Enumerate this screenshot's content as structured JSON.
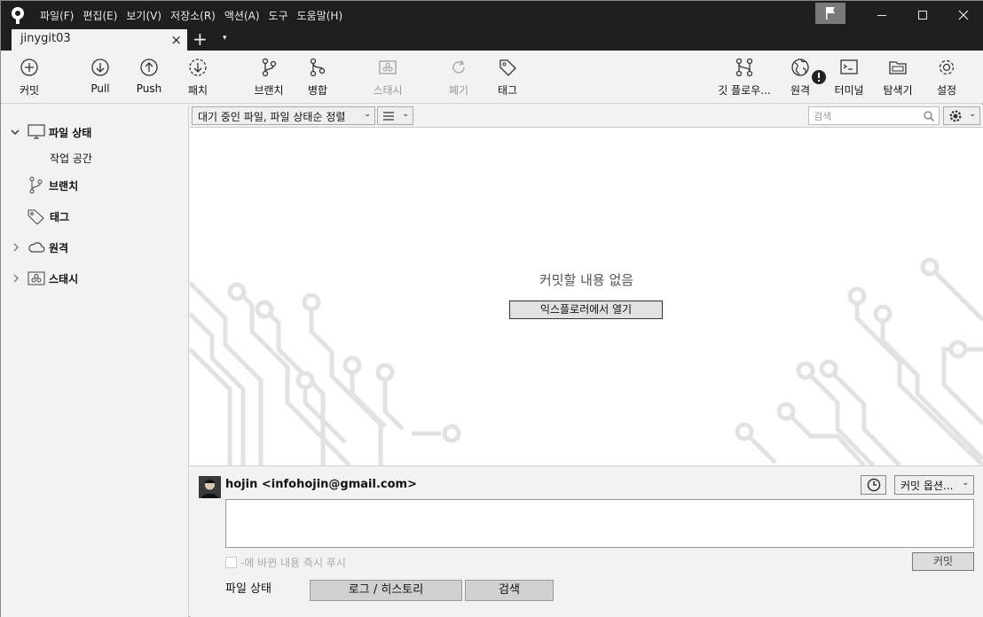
{
  "titlebar": {
    "menu": [
      "파일(F)",
      "편집(E)",
      "보기(V)",
      "저장소(R)",
      "액션(A)",
      "도구",
      "도움말(H)"
    ]
  },
  "tabs": {
    "active": "jinygit03",
    "close": "×",
    "plus": "+",
    "dropdown": "▾"
  },
  "toolbar": {
    "commit": "커밋",
    "pull": "Pull",
    "push": "Push",
    "fetch": "패치",
    "branch": "브랜치",
    "merge": "병합",
    "stash": "스태시",
    "discard": "폐기",
    "tag": "태그",
    "gitflow": "깃 플로우...",
    "remote": "원격",
    "terminal": "터미널",
    "explorer": "탐색기",
    "settings": "설정"
  },
  "sidebar": {
    "file_status": "파일 상태",
    "workspace": "작업 공간",
    "branches": "브랜치",
    "tags": "태그",
    "remotes": "원격",
    "stashes": "스태시"
  },
  "filterbar": {
    "sort": "대기 중인 파일, 파일 상태순 정렬",
    "search_placeholder": "검색"
  },
  "main": {
    "empty_text": "커밋할 내용 없음",
    "open_explorer": "익스플로러에서 열기"
  },
  "commit": {
    "author": "hojin <infohojin@gmail.com>",
    "options": "커밋 옵션...",
    "push_immediately": "-에 바뀐 내용 즉시 푸시",
    "commit_button": "커밋"
  },
  "bottom_tabs": [
    "파일 상태",
    "로그 / 히스토리",
    "검색"
  ],
  "colors": {
    "titlebar": "#1e1e1e",
    "panel": "#f2f2f2",
    "circuit": "#e3e3e3"
  }
}
